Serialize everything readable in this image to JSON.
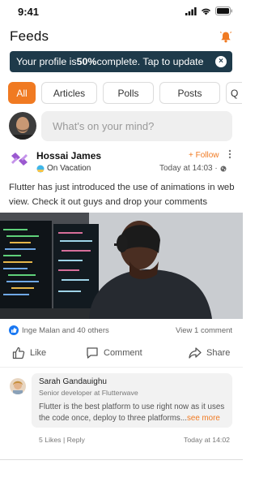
{
  "status_bar": {
    "time": "9:41"
  },
  "header": {
    "title": "Feeds"
  },
  "banner": {
    "text_before": "Your profile is ",
    "percent": "50%",
    "text_after": " complete. Tap to update",
    "close_glyph": "×"
  },
  "tabs": [
    {
      "label": "All",
      "active": true
    },
    {
      "label": "Articles",
      "active": false
    },
    {
      "label": "Polls",
      "active": false
    },
    {
      "label": "Posts",
      "active": false
    },
    {
      "label": "Q",
      "active": false
    }
  ],
  "composer": {
    "placeholder": "What's on your mind?"
  },
  "post": {
    "author": "Hossai James",
    "mood": "On Vacation",
    "follow_label": "+ Follow",
    "time": "Today at 14:03 ·",
    "text": "Flutter has just introduced the use of animations in web view. Check it out guys and drop your comments",
    "likes": "Inge Malan and 40 others",
    "comments_count": "View 1 comment",
    "actions": {
      "like": "Like",
      "comment": "Comment",
      "share": "Share"
    }
  },
  "comment": {
    "name": "Sarah Gandauighu",
    "role": "Senior developer at Flutterwave",
    "text": "Flutter is the best platform to use right now as it uses the code once, deploy to three platforms...",
    "see_more": "see more",
    "meta": "5 Likes | Reply",
    "time": "Today at 14:02"
  },
  "colors": {
    "accent": "#f07a22",
    "banner": "#1e3a4a",
    "like_blue": "#1877f2"
  },
  "icons": [
    "signal-icon",
    "wifi-icon",
    "battery-icon",
    "bell-icon",
    "brand-logo-icon",
    "globe-icon",
    "like-icon",
    "comment-icon",
    "share-icon",
    "thumbs-up-badge-icon",
    "vacation-emoji-icon"
  ]
}
